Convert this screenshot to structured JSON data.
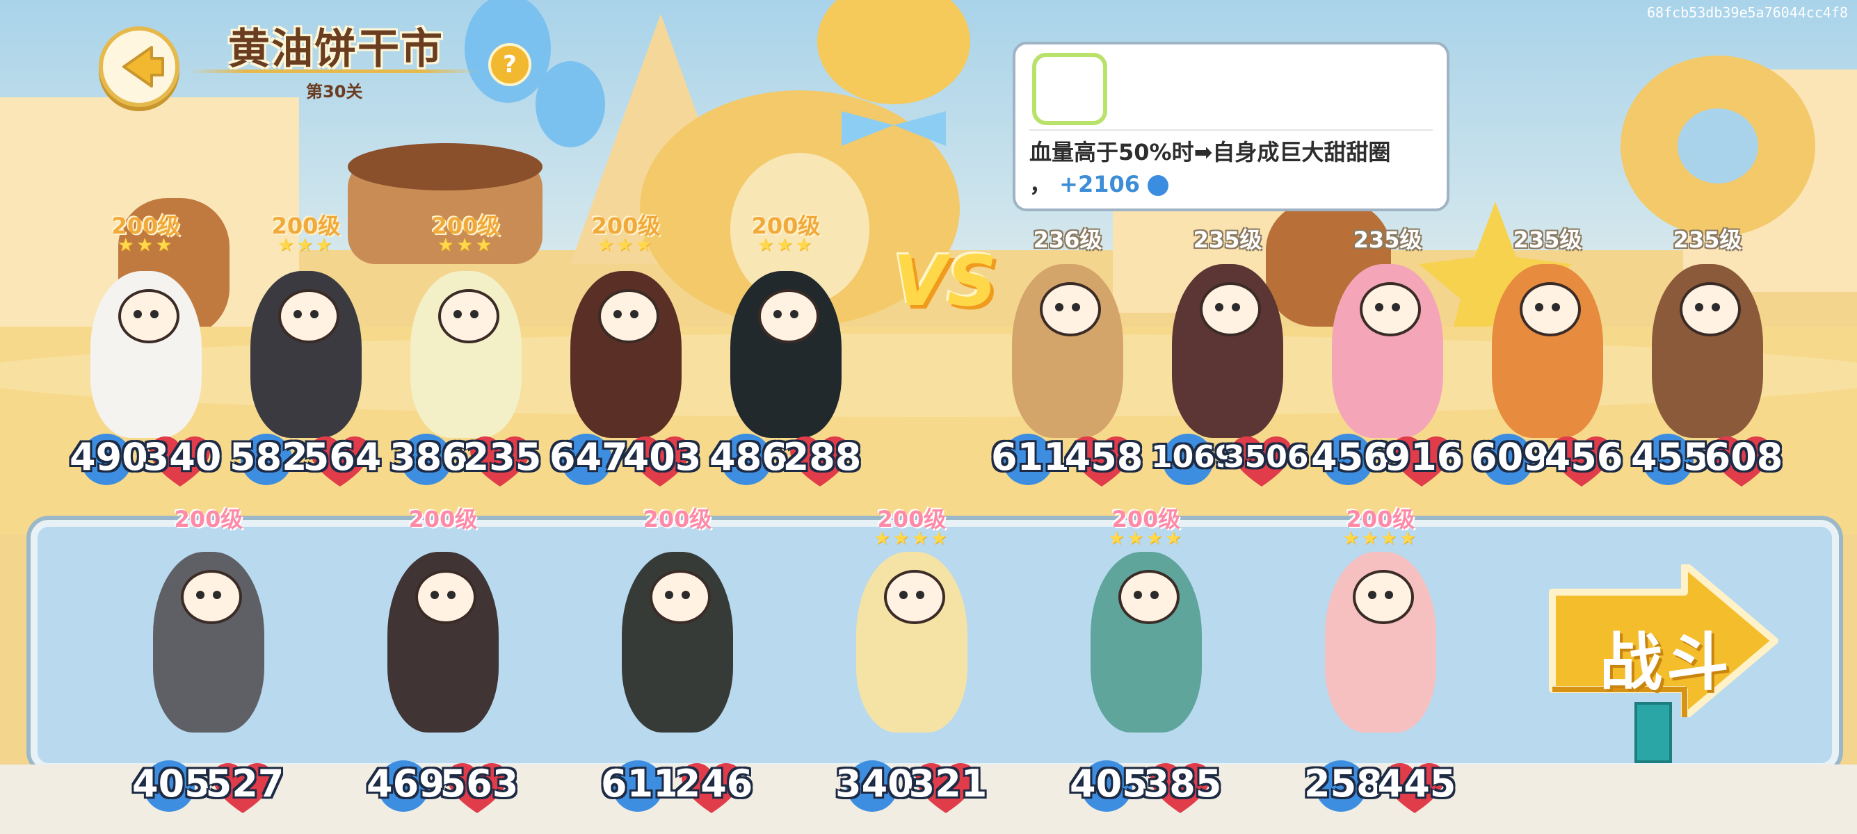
{
  "header": {
    "title": "黄油饼干市",
    "stage": "第30关",
    "help_symbol": "?",
    "build_id": "68fcb53db39e5a76044cc4f8"
  },
  "tooltip": {
    "condition": "血量高于50%时➡自身成巨大甜甜圈",
    "bonus_prefix": "，",
    "bonus": "+2106"
  },
  "vs_label": "VS",
  "player_team": [
    {
      "name": "angel-cat",
      "level": "200级",
      "stars": "★★★",
      "atk": "490",
      "hp": "340",
      "color": "#f5f3f0"
    },
    {
      "name": "snow-leopard-ninja",
      "level": "200级",
      "stars": "★★★",
      "atk": "582",
      "hp": "564",
      "color": "#3a3a40"
    },
    {
      "name": "flower-fairy",
      "level": "200级",
      "stars": "★★★",
      "atk": "386",
      "hp": "235",
      "color": "#f3f0c8"
    },
    {
      "name": "rock-guitarist",
      "level": "200级",
      "stars": "★★★",
      "atk": "647",
      "hp": "403",
      "color": "#5a3026"
    },
    {
      "name": "swordsman-cat",
      "level": "200级",
      "stars": "★★★",
      "atk": "486",
      "hp": "288",
      "color": "#22292d"
    }
  ],
  "enemy_team": [
    {
      "name": "eyepatch-cheetah",
      "level": "236级",
      "atk": "611",
      "hp": "458",
      "color": "#d4a56a"
    },
    {
      "name": "donut-bear",
      "level": "235级",
      "atk": "1069",
      "hp": "3506",
      "color": "#5b3634"
    },
    {
      "name": "toaster",
      "level": "235级",
      "atk": "456",
      "hp": "916",
      "color": "#f4a6b8"
    },
    {
      "name": "explorer-fox",
      "level": "235级",
      "atk": "609",
      "hp": "456",
      "color": "#e78b3e"
    },
    {
      "name": "pilot-monkey",
      "level": "235级",
      "atk": "455",
      "hp": "608",
      "color": "#8b5a3a"
    }
  ],
  "bench": [
    {
      "name": "armored-raccoon",
      "level": "200级",
      "stars": "",
      "atk": "405",
      "hp": "527",
      "color": "#5f6066"
    },
    {
      "name": "devil-cat",
      "level": "200级",
      "stars": "",
      "atk": "469",
      "hp": "563",
      "color": "#403435"
    },
    {
      "name": "witch-grandma",
      "level": "200级",
      "stars": "",
      "atk": "611",
      "hp": "246",
      "color": "#363b38"
    },
    {
      "name": "sprout-boy",
      "level": "200级",
      "stars": "★★★★",
      "atk": "340",
      "hp": "321",
      "color": "#f5e3a6"
    },
    {
      "name": "garden-gnome",
      "level": "200级",
      "stars": "★★★★",
      "atk": "405",
      "hp": "385",
      "color": "#5fa59c"
    },
    {
      "name": "bunny-chef",
      "level": "200级",
      "stars": "★★★★",
      "atk": "258",
      "hp": "445",
      "color": "#f6bfc0"
    }
  ],
  "fight_button": {
    "label": "战斗"
  },
  "colors": {
    "atk": "#3d8ee0",
    "hp": "#e03c4a",
    "accent": "#f2b82f"
  }
}
